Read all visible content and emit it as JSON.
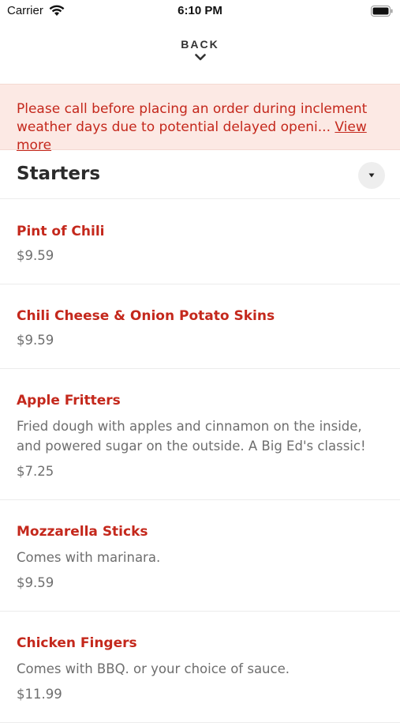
{
  "status_bar": {
    "carrier": "Carrier",
    "time": "6:10 PM"
  },
  "nav": {
    "back_label": "BACK"
  },
  "banner": {
    "text": "Please call before placing an order during inclement weather days due to potential delayed openi...",
    "link_label": "View more",
    "background_color": "#fce9e4",
    "text_color": "#c4281c"
  },
  "section": {
    "title": "Starters"
  },
  "menu_items": [
    {
      "name": "Pint of Chili",
      "description": "",
      "price": "$9.59"
    },
    {
      "name": "Chili Cheese & Onion Potato Skins",
      "description": "",
      "price": "$9.59"
    },
    {
      "name": "Apple Fritters",
      "description": "Fried dough with apples and cinnamon on the inside, and powered sugar on the outside. A Big Ed's classic!",
      "price": "$7.25"
    },
    {
      "name": "Mozzarella Sticks",
      "description": "Comes with marinara.",
      "price": "$9.59"
    },
    {
      "name": "Chicken Fingers",
      "description": "Comes with BBQ. or your choice of sauce.",
      "price": "$11.99"
    }
  ],
  "icons": {
    "wifi": "wifi-icon",
    "battery": "battery-icon",
    "back_chevron": "chevron-down-icon",
    "section_toggle": "caret-down-icon"
  }
}
